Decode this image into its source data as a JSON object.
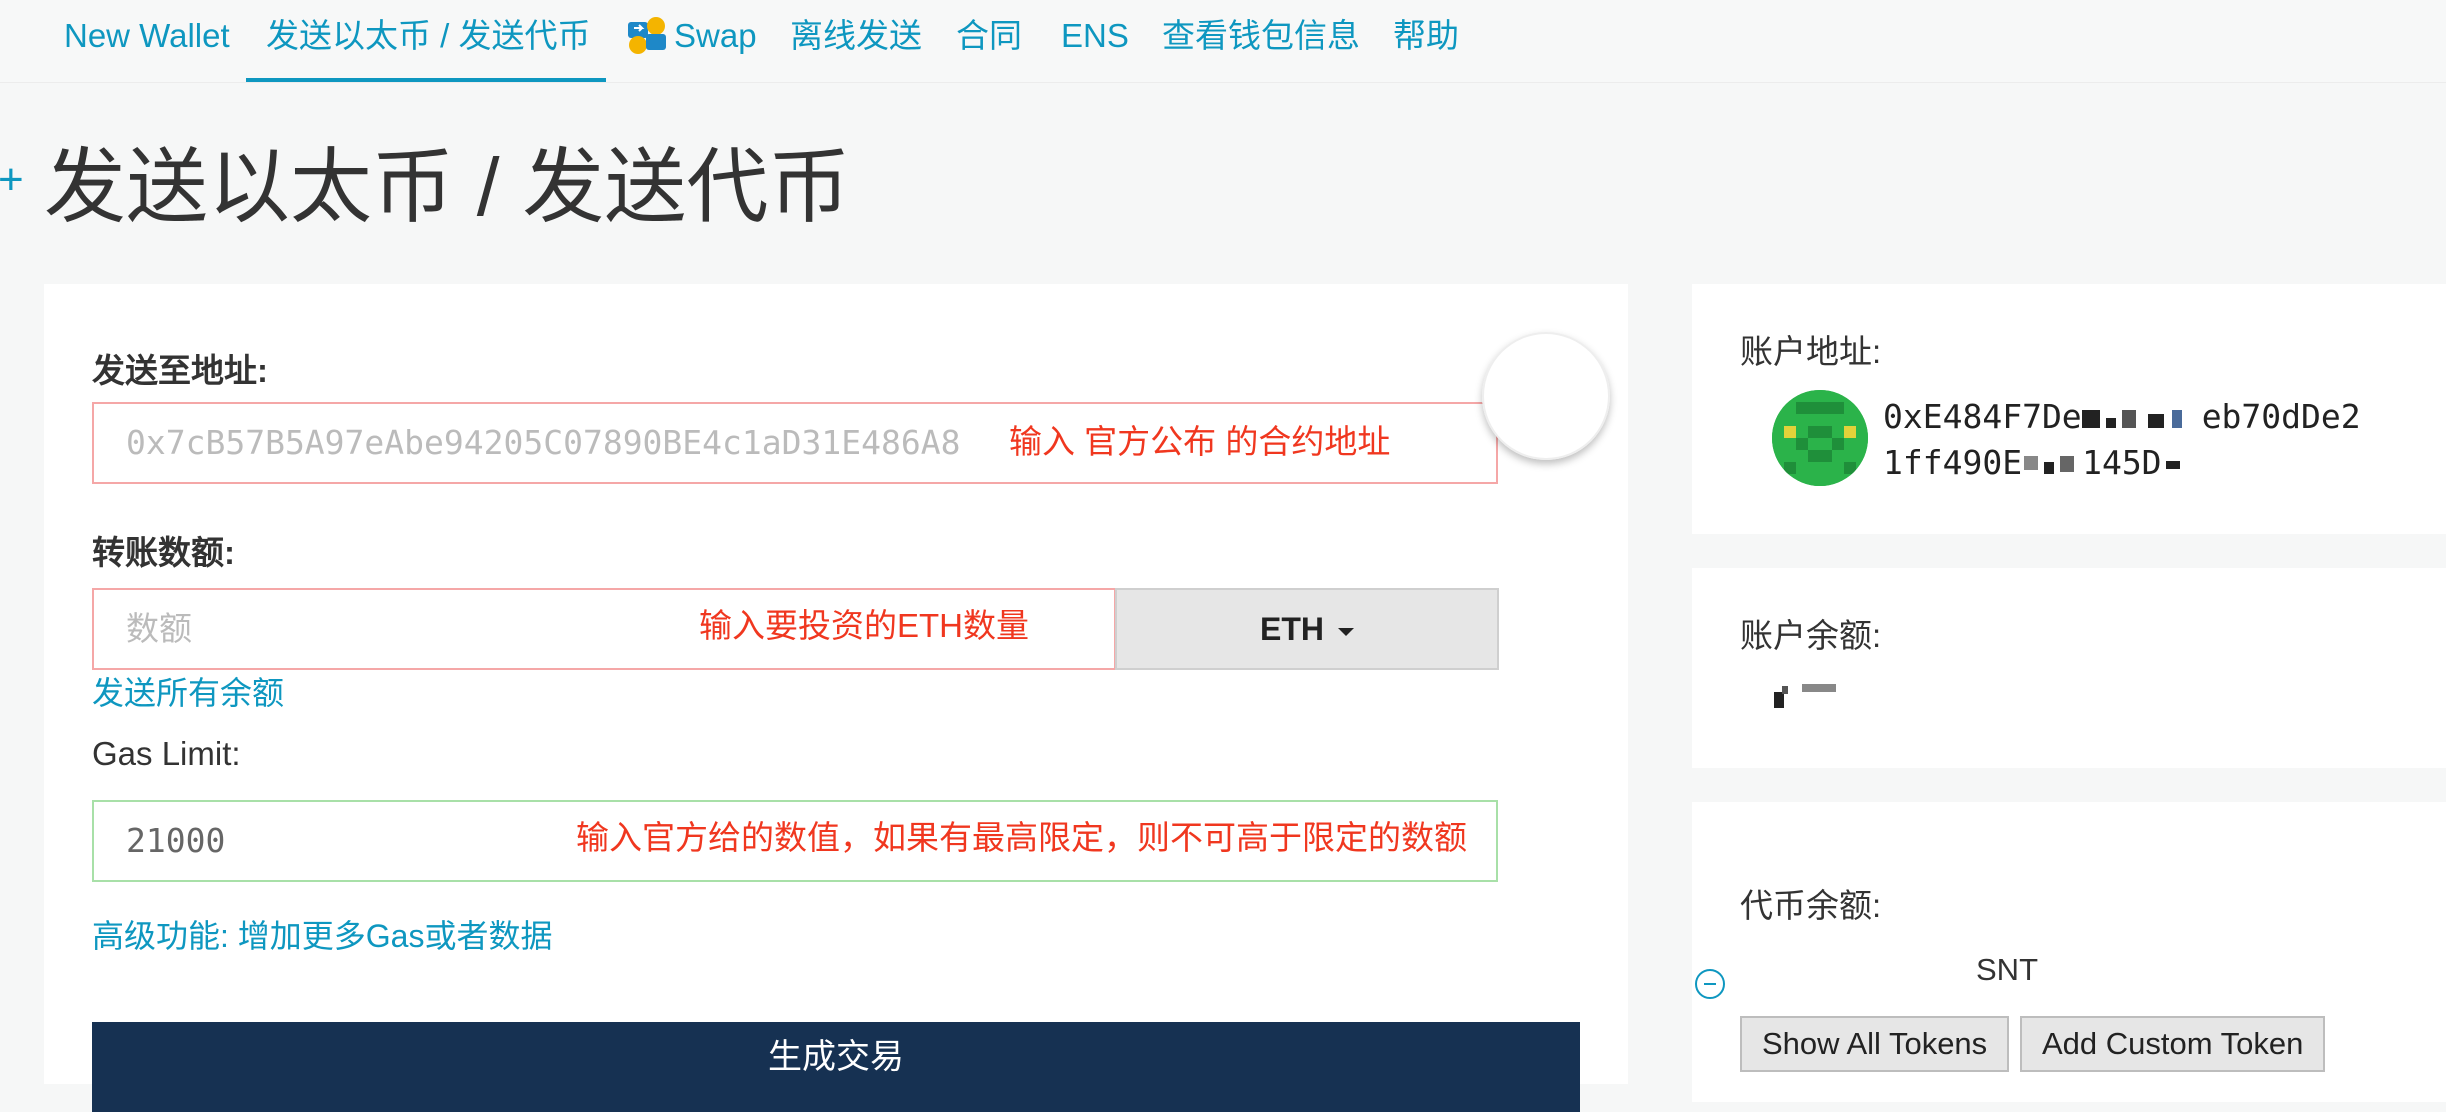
{
  "nav": {
    "items": [
      "New Wallet",
      "发送以太币 / 发送代币",
      "Swap",
      "离线发送",
      "合同",
      "ENS",
      "查看钱包信息",
      "帮助"
    ],
    "active_index": 1
  },
  "page": {
    "plus": "+",
    "title": "发送以太币 / 发送代币"
  },
  "form": {
    "to_label": "发送至地址:",
    "to_placeholder": "0x7cB57B5A97eAbe94205C07890BE4c1aD31E486A8",
    "to_annotation": "输入 官方公布 的合约地址",
    "amount_label": "转账数额:",
    "amount_placeholder": "数额",
    "amount_annotation": "输入要投资的ETH数量",
    "unit": "ETH",
    "send_all": "发送所有余额",
    "gas_label": "Gas Limit:",
    "gas_value": "21000",
    "gas_annotation": "输入官方给的数值，如果有最高限定，则不可高于限定的数额",
    "advanced": "高级功能: 增加更多Gas或者数据",
    "generate": "生成交易"
  },
  "sidebar": {
    "address_label": "账户地址:",
    "address_line1": "0xE484F7De",
    "address_line1_end": "eb70dDe2",
    "address_line2": "1ff490E",
    "address_line2_end": "145D",
    "balance_label": "账户余额:",
    "token_label": "代币余额:",
    "token_symbol": "SNT",
    "show_all": "Show All Tokens",
    "add_custom": "Add Custom Token"
  },
  "colors": {
    "accent": "#0e97c0",
    "annotation": "#f0371f",
    "primary_button": "#163152"
  }
}
